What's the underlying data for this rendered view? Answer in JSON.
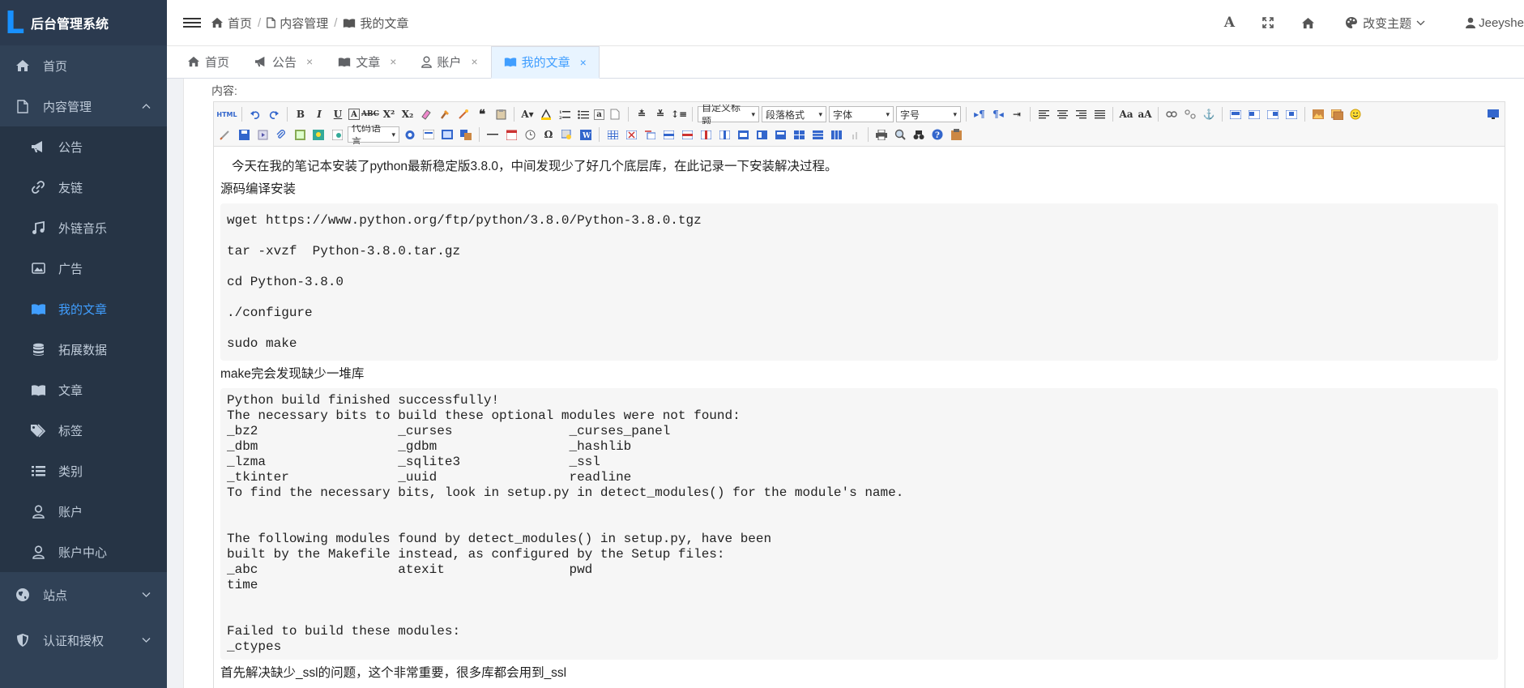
{
  "app": {
    "title": "后台管理系统",
    "logo_letter": "L"
  },
  "sidebar": {
    "items": [
      {
        "label": "首页",
        "icon": "home-icon",
        "level": "top"
      },
      {
        "label": "内容管理",
        "icon": "file-icon",
        "level": "top",
        "expanded": true
      },
      {
        "label": "公告",
        "icon": "bullhorn-icon",
        "level": "sub"
      },
      {
        "label": "友链",
        "icon": "link-icon",
        "level": "sub"
      },
      {
        "label": "外链音乐",
        "icon": "music-icon",
        "level": "sub"
      },
      {
        "label": "广告",
        "icon": "image-icon",
        "level": "sub"
      },
      {
        "label": "我的文章",
        "icon": "book-icon",
        "level": "sub",
        "active": true
      },
      {
        "label": "拓展数据",
        "icon": "database-icon",
        "level": "sub"
      },
      {
        "label": "文章",
        "icon": "book-icon",
        "level": "sub"
      },
      {
        "label": "标签",
        "icon": "tags-icon",
        "level": "sub"
      },
      {
        "label": "类别",
        "icon": "list-icon",
        "level": "sub"
      },
      {
        "label": "账户",
        "icon": "user-icon",
        "level": "sub"
      },
      {
        "label": "账户中心",
        "icon": "user-icon",
        "level": "sub"
      },
      {
        "label": "站点",
        "icon": "globe-icon",
        "level": "top"
      },
      {
        "label": "认证和授权",
        "icon": "shield-icon",
        "level": "top"
      }
    ]
  },
  "navbar": {
    "breadcrumb": [
      {
        "label": "首页",
        "icon": "home-icon"
      },
      {
        "label": "内容管理",
        "icon": "file-icon"
      },
      {
        "label": "我的文章",
        "icon": "book-icon"
      }
    ],
    "font_size_icon": "A",
    "theme_label": "改变主题",
    "user_name": "Jeeyshe"
  },
  "tabs": [
    {
      "label": "首页",
      "icon": "home-icon",
      "closable": false
    },
    {
      "label": "公告",
      "icon": "bullhorn-icon",
      "closable": true
    },
    {
      "label": "文章",
      "icon": "book-icon",
      "closable": true
    },
    {
      "label": "账户",
      "icon": "user-icon",
      "closable": true
    },
    {
      "label": "我的文章",
      "icon": "book-icon",
      "closable": true,
      "active": true
    }
  ],
  "form": {
    "content_label": "内容:"
  },
  "toolbar": {
    "html_label": "HTML",
    "selects": {
      "code_lang": "代码语言",
      "custom_title": "自定义标题",
      "paragraph": "段落格式",
      "font_family": "字体",
      "font_size": "字号"
    }
  },
  "document": {
    "intro": "今天在我的笔记本安装了python最新稳定版3.8.0，中间发现少了好几个底层库，在此记录一下安装解决过程。",
    "heading1": "源码编译安装",
    "code1": "wget https://www.python.org/ftp/python/3.8.0/Python-3.8.0.tgz\ntar -xvzf  Python-3.8.0.tar.gz\ncd Python-3.8.0\n./configure\nsudo make",
    "heading2": "make完会发现缺少一堆库",
    "code2": "Python build finished successfully!\nThe necessary bits to build these optional modules were not found:\n_bz2                  _curses               _curses_panel\n_dbm                  _gdbm                 _hashlib\n_lzma                 _sqlite3              _ssl\n_tkinter              _uuid                 readline\nTo find the necessary bits, look in setup.py in detect_modules() for the module's name.\n\n\nThe following modules found by detect_modules() in setup.py, have been\nbuilt by the Makefile instead, as configured by the Setup files:\n_abc                  atexit                pwd\ntime\n\n\nFailed to build these modules:\n_ctypes",
    "heading3": "首先解决缺少_ssl的问题，这个非常重要，很多库都会用到_ssl"
  },
  "colors": {
    "sidebar_bg": "#304156",
    "sidebar_sub_bg": "#263445",
    "accent": "#409eff",
    "logo": "#1890ff"
  }
}
